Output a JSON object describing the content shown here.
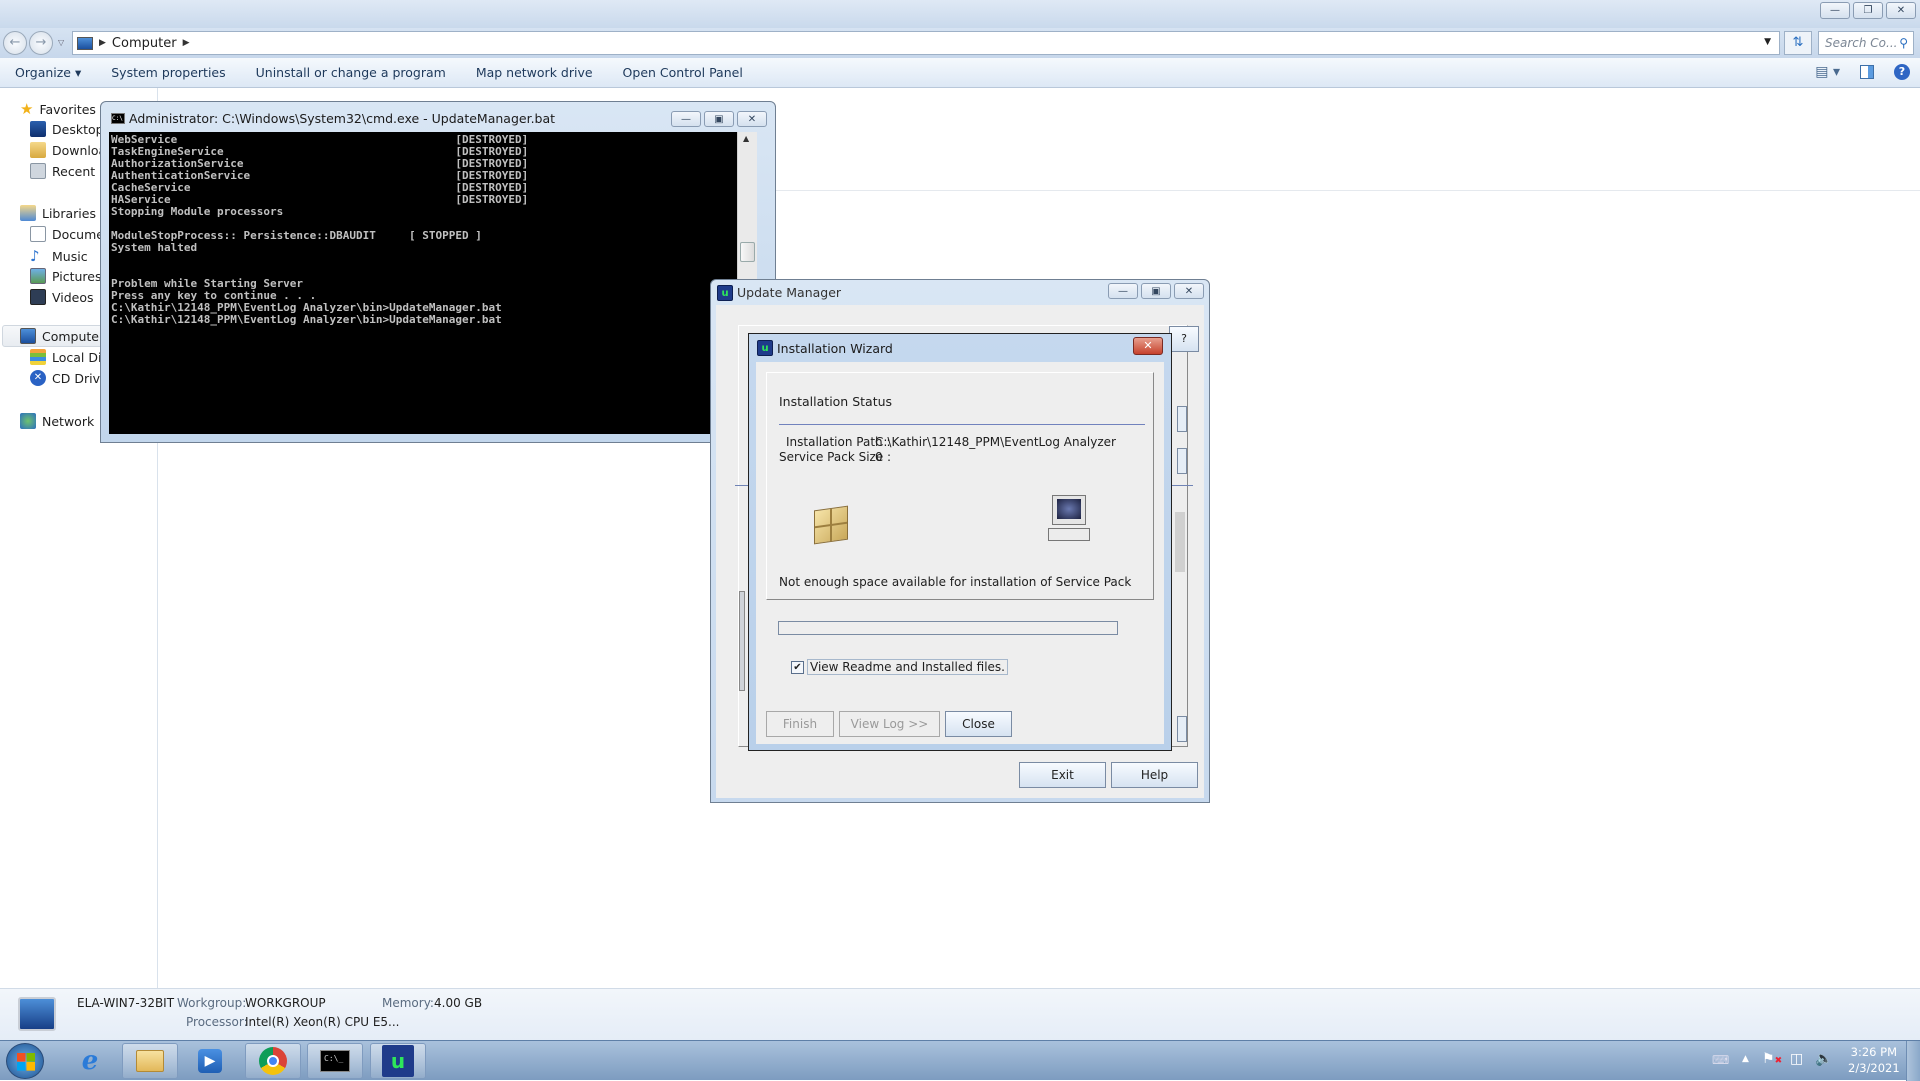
{
  "explorer": {
    "breadcrumb": [
      "Computer"
    ],
    "search_placeholder": "Search Co...",
    "toolbar": {
      "organize": "Organize",
      "system_properties": "System properties",
      "uninstall": "Uninstall or change a program",
      "map_drive": "Map network drive",
      "control_panel": "Open Control Panel"
    },
    "sidebar": {
      "favorites": "Favorites",
      "favorites_items": [
        "Desktop",
        "Downloads",
        "Recent Places"
      ],
      "libraries": "Libraries",
      "libraries_items": [
        "Documents",
        "Music",
        "Pictures",
        "Videos"
      ],
      "computer": "Computer",
      "computer_items": [
        "Local Disk",
        "CD Drive"
      ],
      "network": "Network"
    },
    "status": {
      "name": "ELA-WIN7-32BIT",
      "workgroup_label": "Workgroup:",
      "workgroup": "WORKGROUP",
      "memory_label": "Memory:",
      "memory": "4.00 GB",
      "processor_label": "Processor:",
      "processor": "Intel(R) Xeon(R) CPU E5..."
    }
  },
  "cmd": {
    "title": "Administrator: C:\\Windows\\System32\\cmd.exe - UpdateManager.bat",
    "lines": [
      "WebService                                          [DESTROYED]",
      "TaskEngineService                                   [DESTROYED]",
      "AuthorizationService                                [DESTROYED]",
      "AuthenticationService                               [DESTROYED]",
      "CacheService                                        [DESTROYED]",
      "HAService                                           [DESTROYED]",
      "Stopping Module processors",
      "",
      "ModuleStopProcess:: Persistence::DBAUDIT     [ STOPPED ]",
      "System halted",
      "",
      "",
      "Problem while Starting Server",
      "Press any key to continue . . .",
      "C:\\Kathir\\12148_PPM\\EventLog Analyzer\\bin>UpdateManager.bat",
      "C:\\Kathir\\12148_PPM\\EventLog Analyzer\\bin>UpdateManager.bat"
    ]
  },
  "update_manager": {
    "title": "Update Manager",
    "exit": "Exit",
    "help": "Help"
  },
  "wizard": {
    "title": "Installation Wizard",
    "heading": "Installation Status",
    "path_label": "Installation Path :",
    "path_value": "C:\\Kathir\\12148_PPM\\EventLog Analyzer",
    "size_label": "Service Pack Size :",
    "size_value": "0",
    "message": "Not enough space available for installation of Service Pack",
    "progress": 0,
    "checkbox_label": "View Readme and Installed files.",
    "checkbox_checked": true,
    "finish": "Finish",
    "view_log": "View Log >>",
    "close": "Close"
  },
  "tray": {
    "time": "3:26 PM",
    "date": "2/3/2021"
  }
}
